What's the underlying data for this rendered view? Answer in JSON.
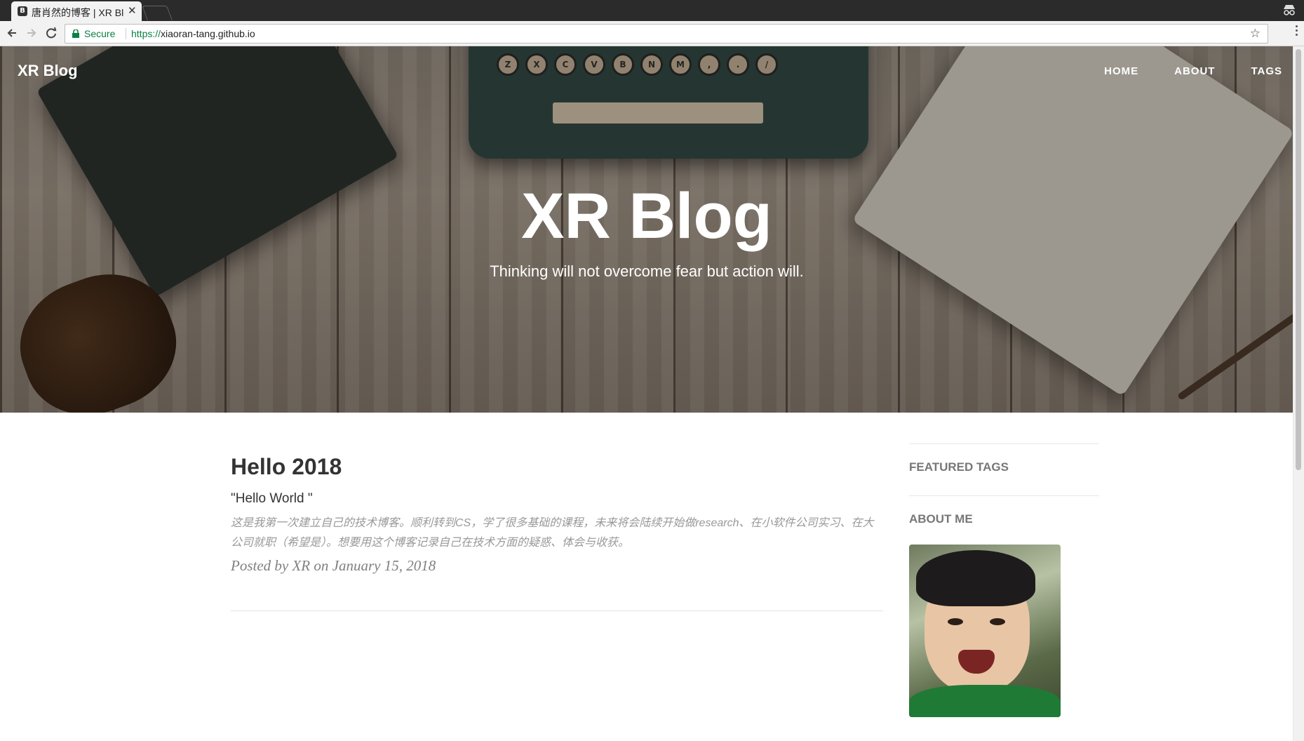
{
  "browser": {
    "tab_title": "唐肖然的博客 | XR Blog",
    "favicon_letter": "B",
    "secure_label": "Secure",
    "url_scheme": "https://",
    "url_host": "xiaoran-tang.github.io"
  },
  "site": {
    "brand": "XR Blog",
    "nav": [
      "HOME",
      "ABOUT",
      "TAGS"
    ],
    "hero_title": "XR Blog",
    "hero_subtitle": "Thinking will not overcome fear but action will."
  },
  "typewriter_keys": [
    "Z",
    "X",
    "C",
    "V",
    "B",
    "N",
    "M",
    ",",
    ".",
    "/"
  ],
  "post": {
    "title": "Hello 2018",
    "subtitle": "\"Hello World \"",
    "excerpt": "这是我第一次建立自己的技术博客。顺利转到CS，学了很多基础的课程，未来将会陆续开始做research、在小软件公司实习、在大公司就职（希望是）。想要用这个博客记录自己在技术方面的疑惑、体会与收获。",
    "meta": "Posted by XR on January 15, 2018"
  },
  "sidebar": {
    "featured_tags_heading": "FEATURED TAGS",
    "about_me_heading": "ABOUT ME"
  },
  "colors": {
    "secure_green": "#0b8043",
    "heading_text": "#333333",
    "muted_text": "#999999"
  }
}
